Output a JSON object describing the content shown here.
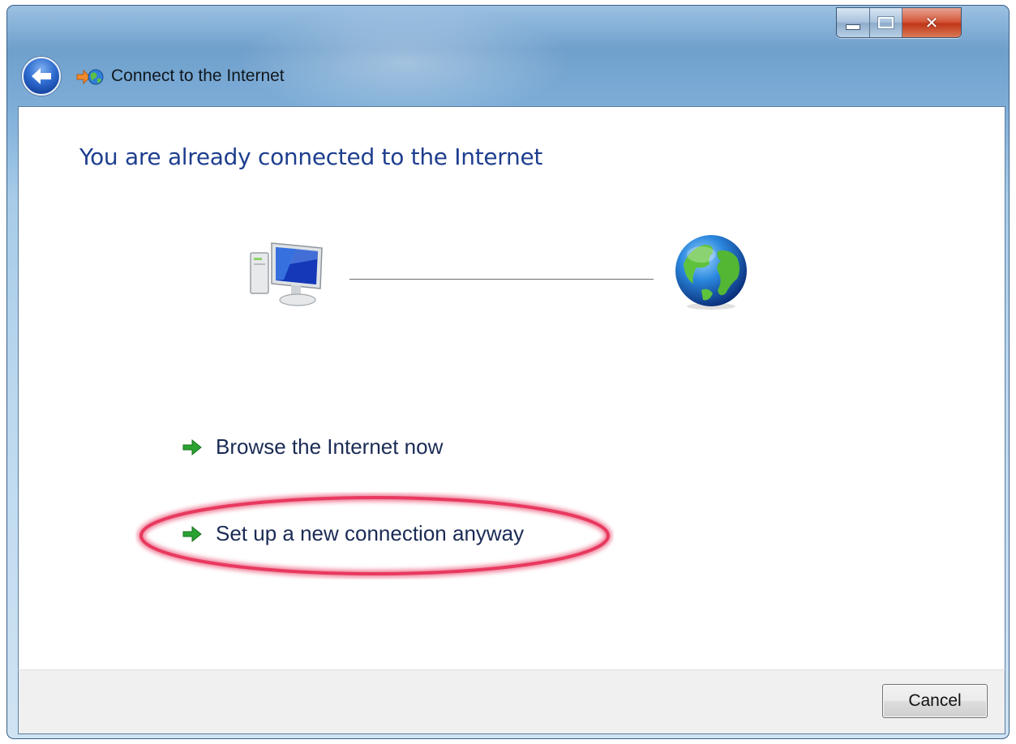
{
  "window": {
    "title": "Connect to the Internet",
    "controls": [
      "minimize-icon",
      "maximize-icon",
      "close-icon"
    ]
  },
  "content": {
    "heading": "You are already connected to the Internet",
    "diagram": {
      "left_icon": "computer-icon",
      "right_icon": "globe-icon"
    },
    "options": [
      {
        "label": "Browse the Internet now",
        "icon": "green-arrow-icon"
      },
      {
        "label": "Set up a new connection anyway",
        "icon": "green-arrow-icon",
        "highlighted": true
      }
    ]
  },
  "footer": {
    "cancel_label": "Cancel"
  },
  "colors": {
    "heading": "#1e3e8f",
    "link": "#1b2b55",
    "highlight": "#e8395f",
    "arrow": "#2aa232"
  }
}
